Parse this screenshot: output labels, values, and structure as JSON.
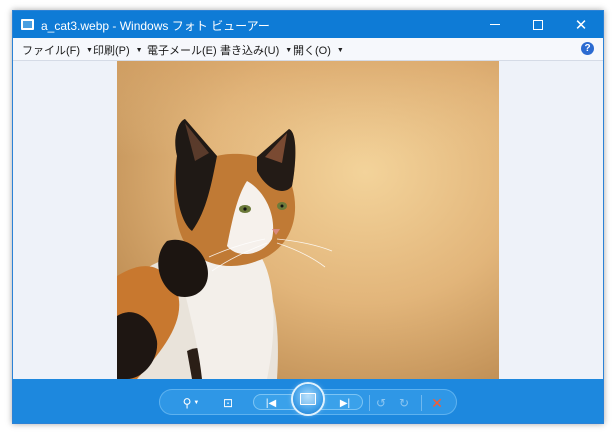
{
  "window": {
    "title": "a_cat3.webp - Windows フォト ビューアー",
    "controls": {
      "minimize": "",
      "maximize": "",
      "close": "✕"
    }
  },
  "menu": [
    {
      "label": "ファイル(F)"
    },
    {
      "label": "印刷(P)"
    },
    {
      "label": "電子メール(E)"
    },
    {
      "label": "書き込み(U)"
    },
    {
      "label": "開く(O)"
    }
  ],
  "help": {
    "glyph": "?"
  },
  "toolbar": {
    "zoom_glyph": "⚲",
    "fit_glyph": "⊡",
    "prev_glyph": "|◀",
    "next_glyph": "▶|",
    "rotate_ccw_glyph": "↺",
    "rotate_cw_glyph": "↻",
    "delete_glyph": "✕"
  },
  "colors": {
    "titlebar": "#0e7bd6",
    "toolbar": "#1d88de",
    "delete": "#ff5a2a"
  }
}
